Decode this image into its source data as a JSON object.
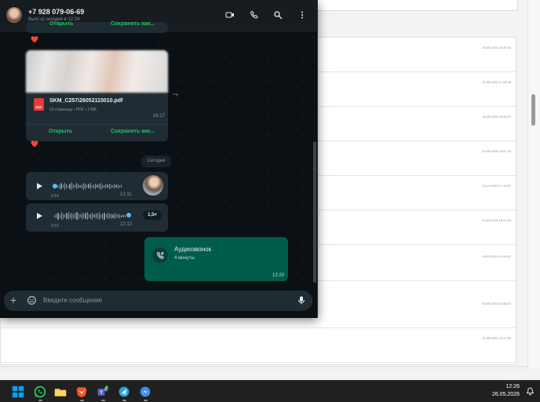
{
  "background_window": {
    "dates": [
      "25.05.2026 14:49:00",
      "21.05.2026 17:28:38",
      "16.05.2026 15:01:37",
      "13.05.2026 15:07:10",
      "23.10.2024 17:14:07",
      "02.09.2024 15:21:20",
      "03.09.2024 11:09:52",
      "30.08.2024 12:08:01",
      "21.08.2024 13:17:56"
    ]
  },
  "chat": {
    "contact_name": "+7 928 079-06-69",
    "contact_status": "был(-а) сегодня в 12:24",
    "header_icons": [
      "video-call-icon",
      "voice-call-icon",
      "search-icon",
      "more-menu-icon"
    ],
    "top_actions": {
      "open": "Открыть",
      "save": "Сохранить как..."
    },
    "reaction": "❤️",
    "document": {
      "file_name": "SKM_C257i26052115010.pdf",
      "meta": "23 страницы • PDF • 3 МБ",
      "time": "16:17",
      "open_label": "Открыть",
      "save_label": "Сохранить как...",
      "badge": "PDF"
    },
    "date_separator": "Сегодня",
    "voice_messages": [
      {
        "duration": "0:14",
        "time": "12:11"
      },
      {
        "duration": "0:15",
        "time": "12:12",
        "speed": "1,5×"
      }
    ],
    "call": {
      "title": "Аудиозвонок",
      "subtitle": "4 минуты",
      "time": "12:20"
    },
    "input_placeholder": "Введите сообщение"
  },
  "taskbar": {
    "apps": [
      "windows-start-icon",
      "whatsapp-icon",
      "file-explorer-icon",
      "brave-icon",
      "teams-icon",
      "telegram-icon",
      "messenger-icon"
    ],
    "clock_time": "12:26",
    "clock_date": "26.05.2026"
  },
  "colors": {
    "accent_green": "#21c063",
    "outgoing_bubble": "#005c4b",
    "incoming_bubble": "#202c33",
    "chat_bg": "#0b1014",
    "taskbar_bg": "#202020"
  }
}
